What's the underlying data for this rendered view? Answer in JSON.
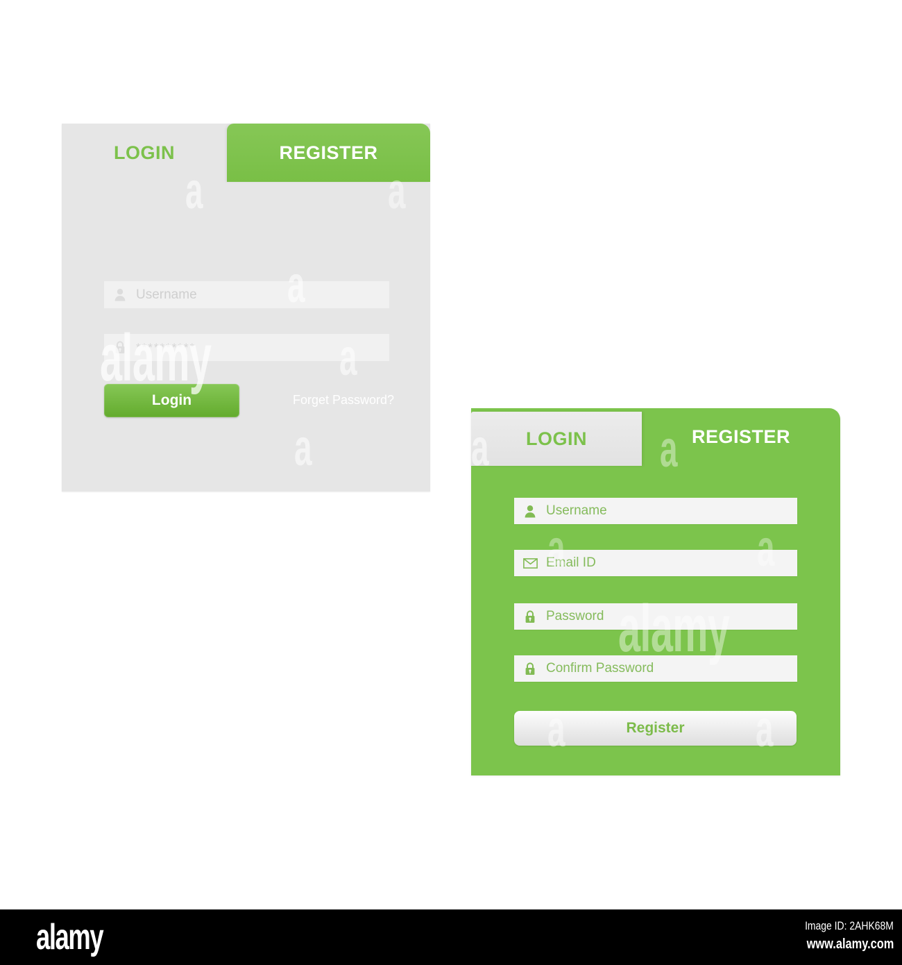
{
  "colors": {
    "brand_green": "#7CC44C",
    "green_text": "#7CC14B",
    "card_gray": "#E6E6E6",
    "input_gray": "#F1F1F1",
    "placeholder_gray": "#CFCFCF",
    "page_background": "#FFFFFF",
    "footer_black": "#000000"
  },
  "login_card": {
    "tabs": [
      {
        "label": "LOGIN",
        "state": "inactive",
        "icon": ""
      },
      {
        "label": "REGISTER",
        "state": "active",
        "icon": ""
      }
    ],
    "fields": [
      {
        "icon": "user-icon",
        "placeholder": "Username",
        "value": "",
        "type": "text"
      },
      {
        "icon": "lock-icon",
        "placeholder": "",
        "value": "**********",
        "type": "password"
      }
    ],
    "submit_label": "Login",
    "forget_label": "Forget Password?"
  },
  "register_card": {
    "tabs": [
      {
        "label": "LOGIN",
        "state": "inactive",
        "icon": ""
      },
      {
        "label": "REGISTER",
        "state": "active",
        "icon": ""
      }
    ],
    "fields": [
      {
        "icon": "user-icon",
        "placeholder": "Username",
        "value": "",
        "type": "text"
      },
      {
        "icon": "envelope-icon",
        "placeholder": "Email ID",
        "value": "",
        "type": "email"
      },
      {
        "icon": "lock-icon",
        "placeholder": "Password",
        "value": "",
        "type": "password"
      },
      {
        "icon": "lock-icon",
        "placeholder": "Confirm Password",
        "value": "",
        "type": "password"
      }
    ],
    "submit_label": "Register"
  },
  "watermark": {
    "word": "alamy",
    "letter": "a"
  },
  "footer": {
    "logo": "alamy",
    "image_id": "Image ID: 2AHK68M",
    "url": "www.alamy.com"
  }
}
